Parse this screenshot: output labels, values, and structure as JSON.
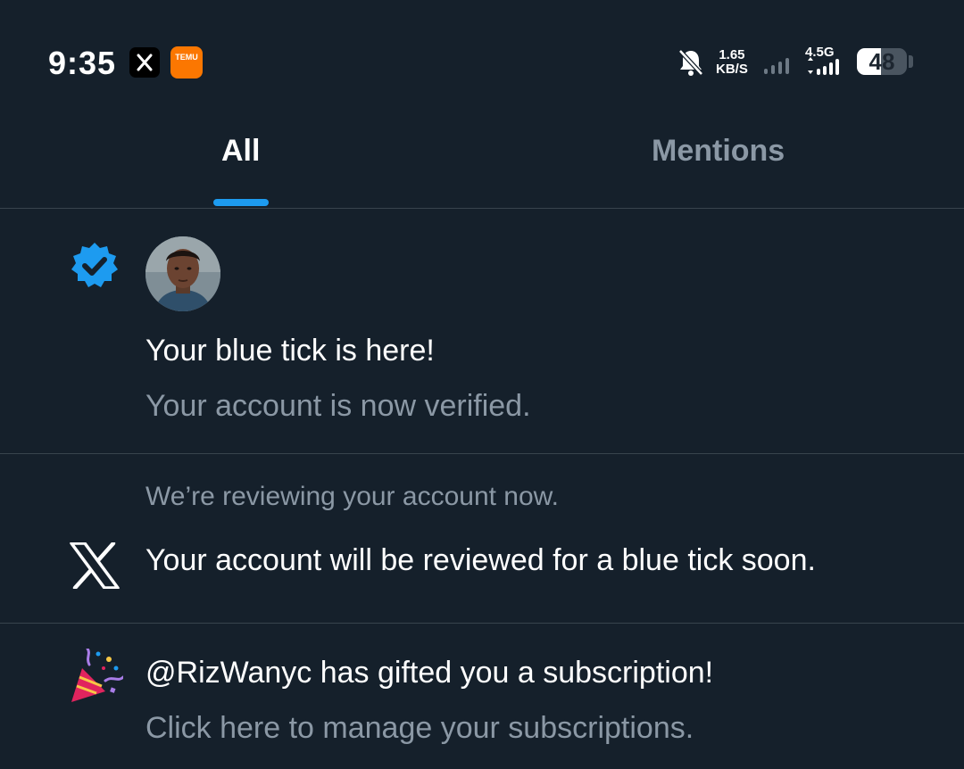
{
  "status_bar": {
    "time": "9:35",
    "app_icons": [
      "x-app-icon",
      "temu-app-icon"
    ],
    "temu_label": "TEMU",
    "net_speed_value": "1.65",
    "net_speed_unit": "KB/S",
    "network_type": "4.5G",
    "battery_percent": "48",
    "battery_level": 0.48
  },
  "tabs": [
    {
      "label": "All",
      "active": true
    },
    {
      "label": "Mentions",
      "active": false
    }
  ],
  "notifications": [
    {
      "icon": "verified-badge-icon",
      "title": "Your blue tick is here!",
      "subtitle": "Your account is now verified."
    },
    {
      "icon": "x-logo-icon",
      "preheader": "We’re reviewing your account now.",
      "title": "Your account will be reviewed for a blue tick soon."
    },
    {
      "icon": "party-popper-icon",
      "title": "@RizWanyc has gifted you a subscription!",
      "subtitle": "Click here to manage your subscriptions."
    }
  ],
  "colors": {
    "background": "#15202b",
    "accent": "#1d9bf0",
    "secondary_text": "#8b98a5",
    "divider": "#38444d"
  }
}
